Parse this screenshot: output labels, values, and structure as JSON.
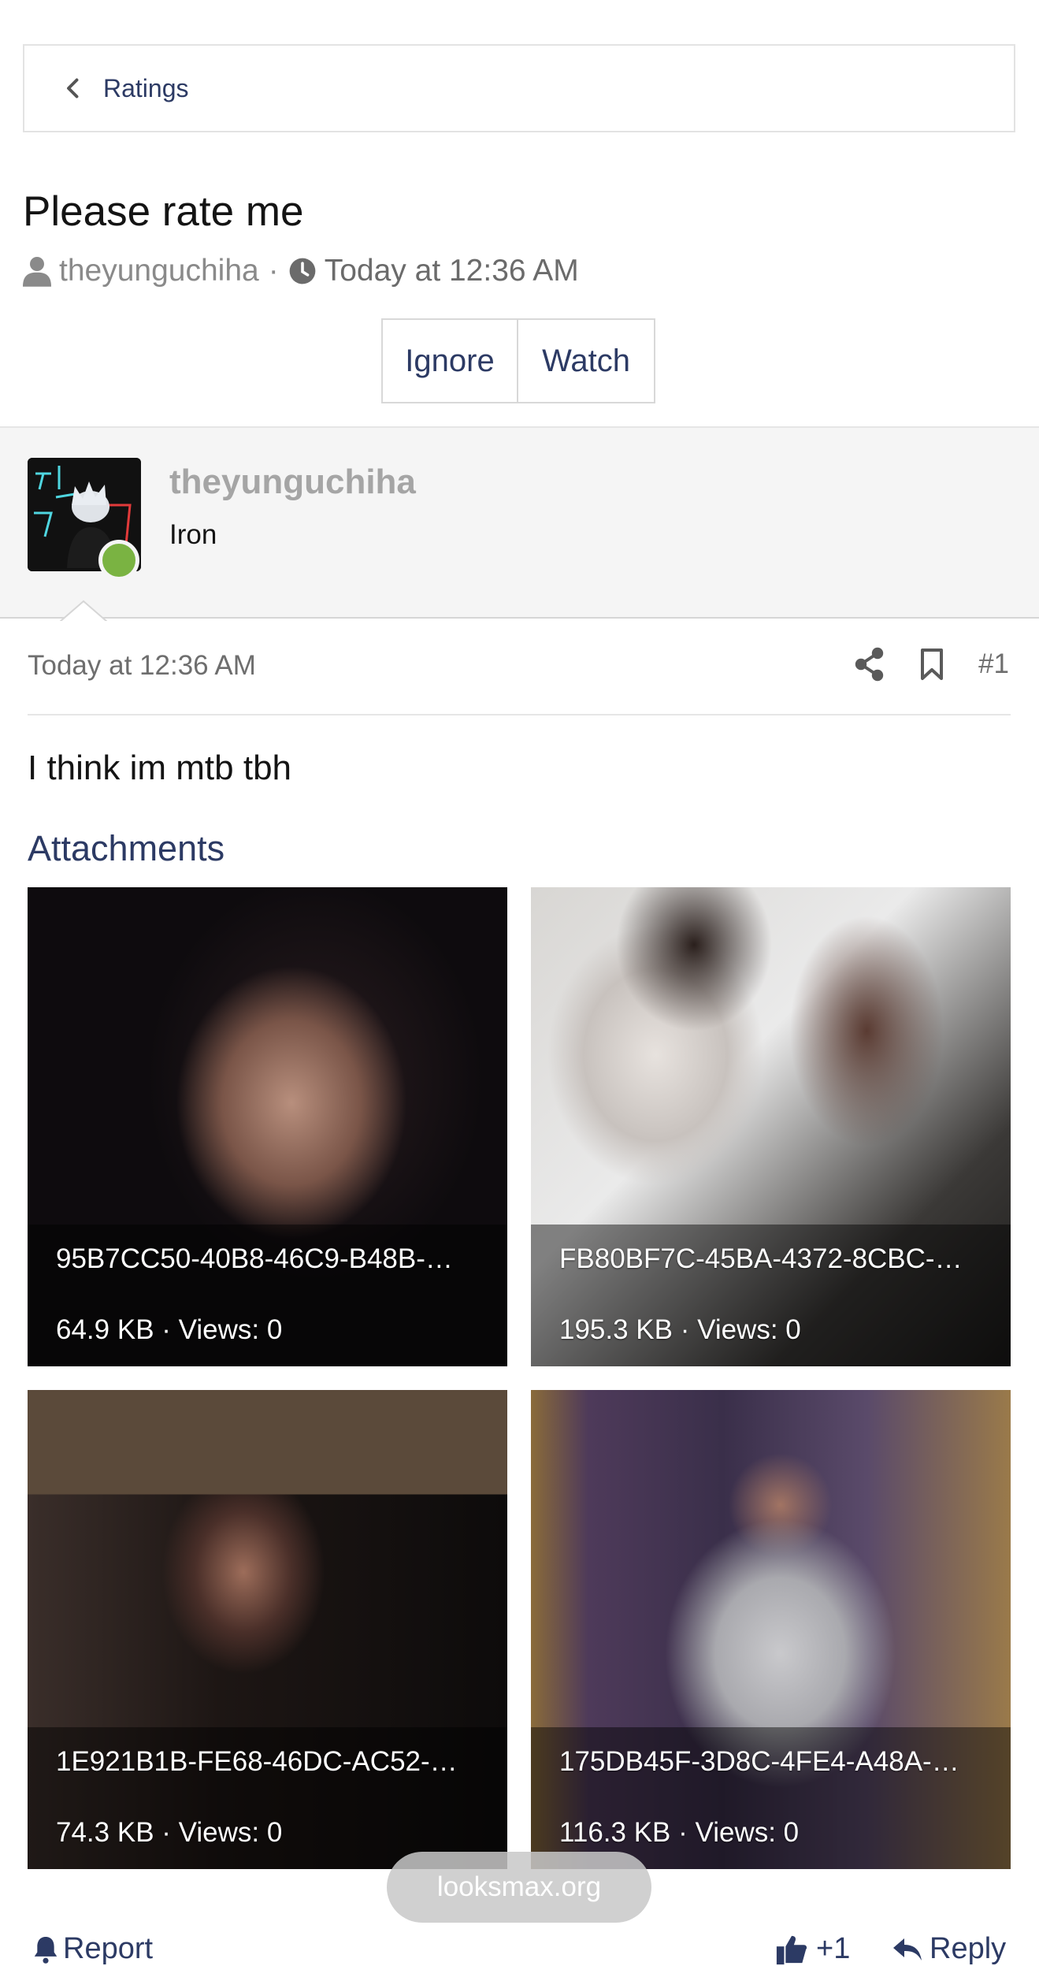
{
  "breadcrumb": {
    "label": "Ratings",
    "icon": "chevron-left-icon"
  },
  "thread": {
    "title": "Please rate me",
    "author": "theyunguchiha",
    "separator": "·",
    "date": "Today at 12:36 AM"
  },
  "actions": {
    "ignore": "Ignore",
    "watch": "Watch"
  },
  "user": {
    "name": "theyunguchiha",
    "rank": "Iron",
    "online_color": "#7ab342"
  },
  "post": {
    "date": "Today at 12:36 AM",
    "number": "#1",
    "body": "I think im mtb tbh",
    "attachments_title": "Attachments",
    "attachments": [
      {
        "name": "95B7CC50-40B8-46C9-B48B-…",
        "meta": "64.9 KB · Views: 0"
      },
      {
        "name": "FB80BF7C-45BA-4372-8CBC-…",
        "meta": "195.3 KB · Views: 0"
      },
      {
        "name": "1E921B1B-FE68-46DC-AC52-…",
        "meta": "74.3 KB · Views: 0"
      },
      {
        "name": "175DB45F-3D8C-4FE4-A48A-…",
        "meta": "116.3 KB · Views: 0"
      }
    ]
  },
  "watermark": "looksmax.org",
  "footer": {
    "report": "Report",
    "like": "+1",
    "reply": "Reply"
  },
  "colors": {
    "link": "#2c3a64",
    "muted": "#8a8a8a",
    "panel": "#f5f5f5"
  }
}
